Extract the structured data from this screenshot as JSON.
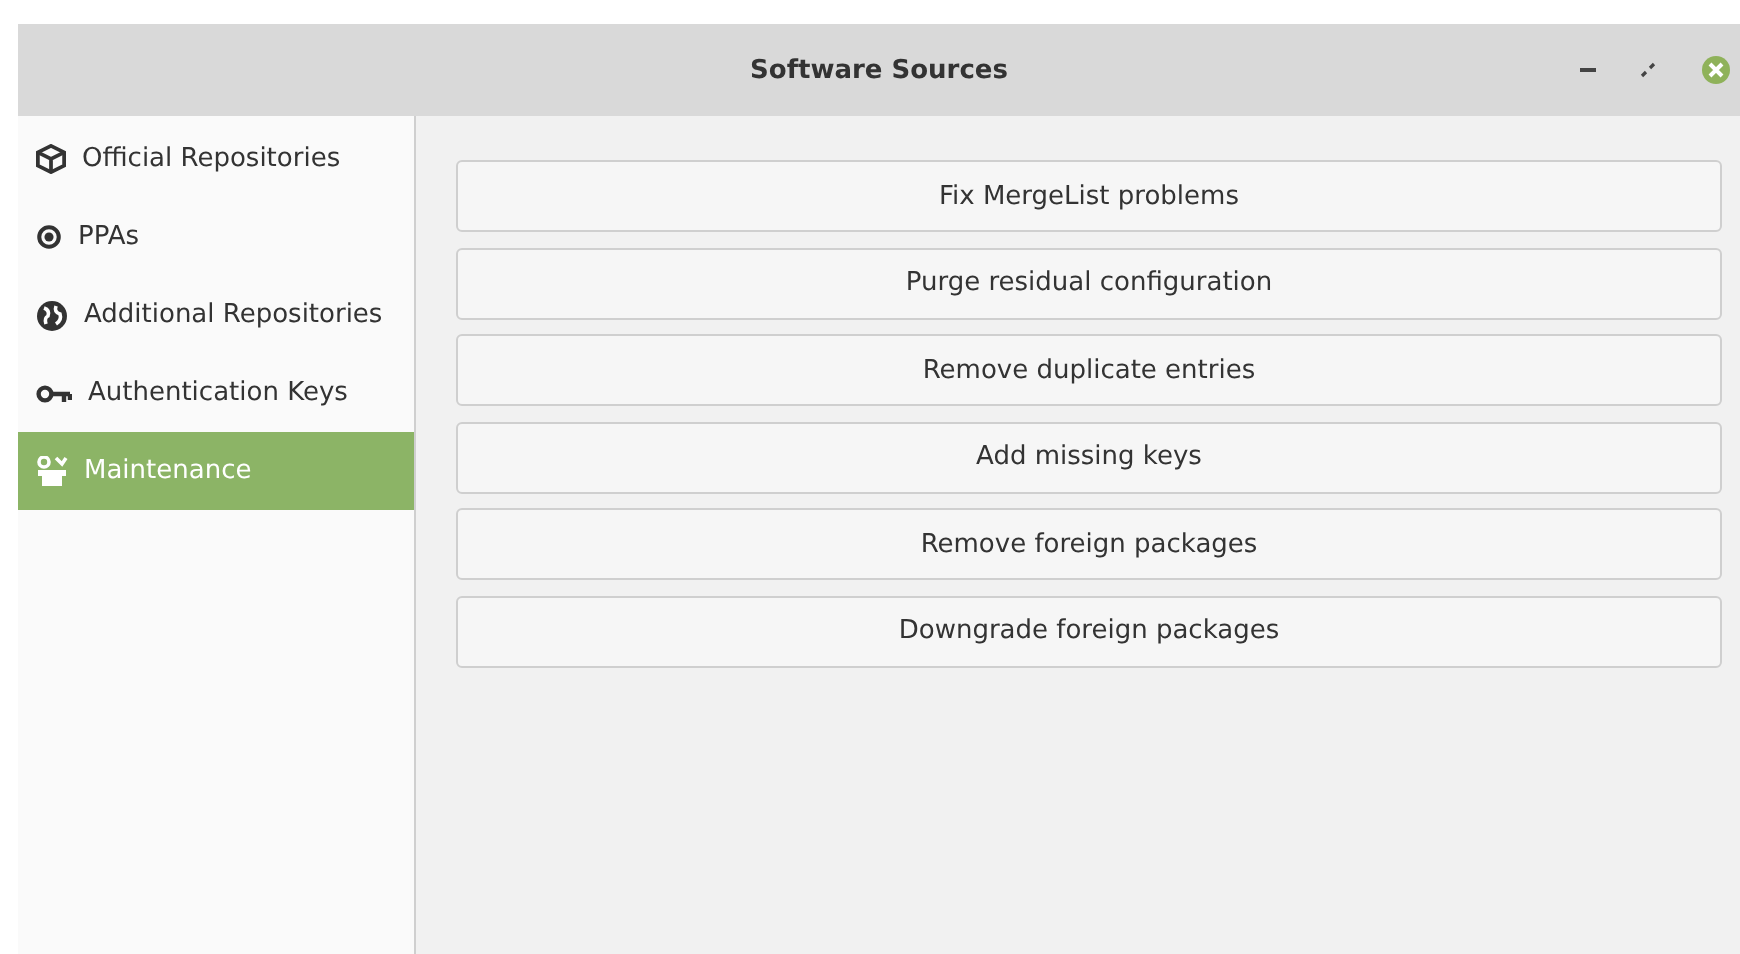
{
  "window": {
    "title": "Software Sources"
  },
  "sidebar": {
    "items": [
      {
        "label": "Official Repositories",
        "selected": false
      },
      {
        "label": "PPAs",
        "selected": false
      },
      {
        "label": "Additional Repositories",
        "selected": false
      },
      {
        "label": "Authentication Keys",
        "selected": false
      },
      {
        "label": "Maintenance",
        "selected": true
      }
    ]
  },
  "buttons": [
    "Fix MergeList problems",
    "Purge residual configuration",
    "Remove duplicate entries",
    "Add missing keys",
    "Remove foreign packages",
    "Downgrade foreign packages"
  ]
}
